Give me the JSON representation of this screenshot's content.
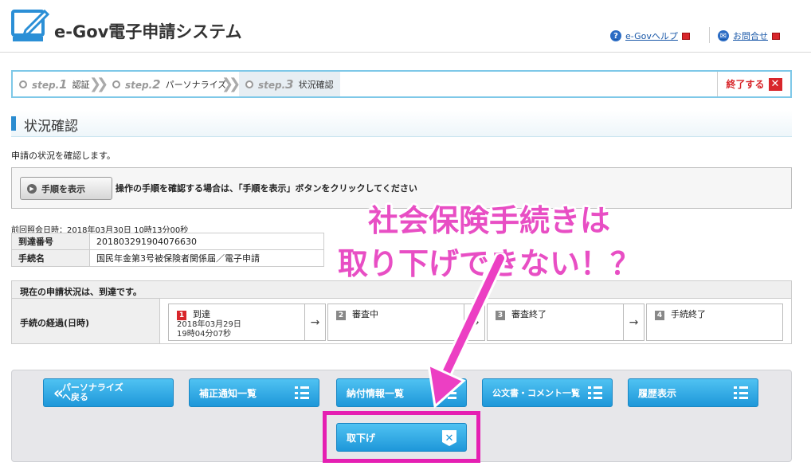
{
  "header": {
    "logo_text": "e-Gov電子申請システム",
    "help_link": "e-Govヘルプ",
    "contact_link": "お問合せ"
  },
  "steps": [
    {
      "prefix": "step.",
      "num": "1",
      "label": "認証"
    },
    {
      "prefix": "step.",
      "num": "2",
      "label": "パーソナライズ"
    },
    {
      "prefix": "step.",
      "num": "3",
      "label": "状況確認"
    }
  ],
  "end_button": "終了する",
  "page_title": "状況確認",
  "description": "申請の状況を確認します。",
  "help": {
    "button_label": "手順を表示",
    "text": "操作の手順を確認する場合は、「手順を表示」ボタンをクリックしてください"
  },
  "last_check": "前回照会日時：2018年03月30日 10時13分00秒",
  "info": [
    {
      "key": "到達番号",
      "value": "201803291904076630"
    },
    {
      "key": "手続名",
      "value": "国民年金第3号被保険者関係届／電子申請"
    }
  ],
  "status": {
    "header": "現在の申請状況は、到達です。",
    "row_label": "手続の経過(日時)",
    "progress": [
      {
        "num": "1",
        "label": "到達",
        "date": "2018年03月29日",
        "time": "19時04分07秒",
        "active": true
      },
      {
        "num": "2",
        "label": "審査中",
        "date": "",
        "time": "",
        "active": false
      },
      {
        "num": "3",
        "label": "審査終了",
        "date": "",
        "time": "",
        "active": false
      },
      {
        "num": "4",
        "label": "手続終了",
        "date": "",
        "time": "",
        "active": false
      }
    ]
  },
  "buttons": {
    "back_line1": "パーソナライズ",
    "back_line2": "へ戻る",
    "correction": "補正通知一覧",
    "payment": "納付情報一覧",
    "documents": "公文書・コメント一覧",
    "history": "履歴表示",
    "withdraw": "取下げ"
  },
  "annotation": {
    "line1": "社会保険手続きは",
    "line2": "取り下げできない！？"
  },
  "colors": {
    "accent_blue": "#1e97d9",
    "annotation_pink": "#e51fb2",
    "step_border": "#7ec8e8",
    "end_red": "#d8262b"
  }
}
